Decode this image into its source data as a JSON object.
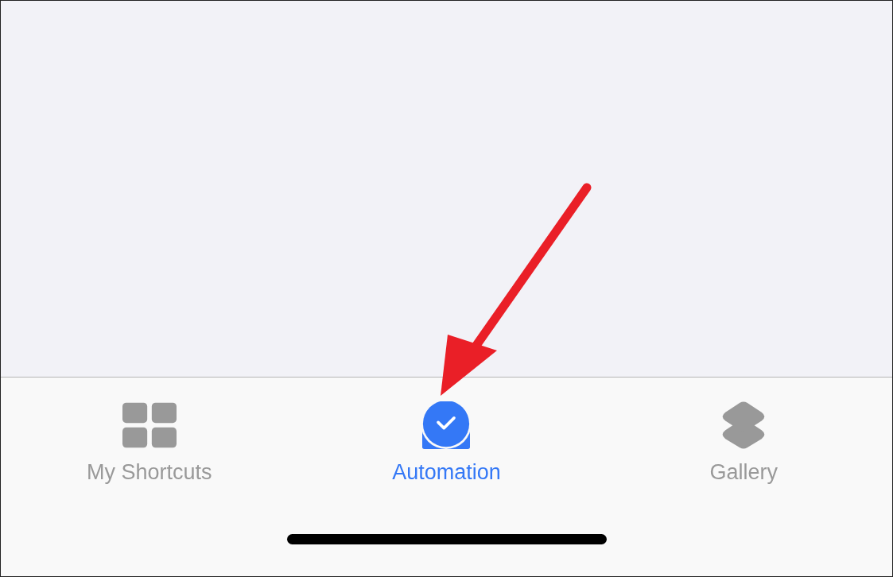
{
  "tab_bar": {
    "tabs": [
      {
        "label": "My Shortcuts",
        "selected": false
      },
      {
        "label": "Automation",
        "selected": true
      },
      {
        "label": "Gallery",
        "selected": false
      }
    ]
  }
}
